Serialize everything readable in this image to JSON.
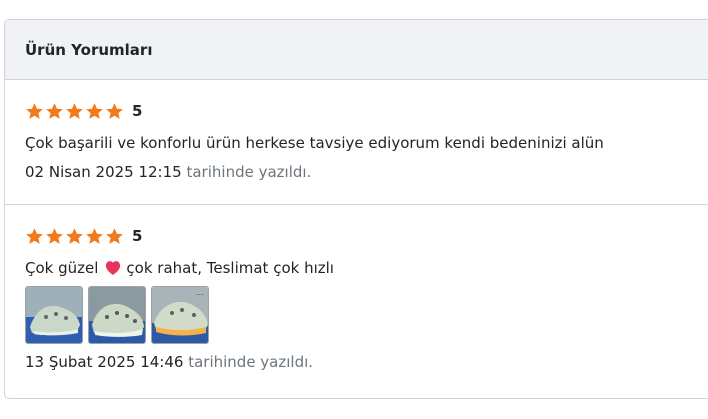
{
  "panel": {
    "title": "Ürün Yorumları"
  },
  "colors": {
    "star": "#f27a1a",
    "heart": "#e8345a",
    "muted": "#6c757d"
  },
  "reviews": [
    {
      "rating": 5,
      "rating_label": "5",
      "comment": "Çok başarili ve konforlu ürün herkese tavsiye ediyorum kendi bedeninizi alün",
      "date": "02 Nisan 2025 12:15",
      "date_suffix": "tarihinde yazıldı."
    },
    {
      "rating": 5,
      "rating_label": "5",
      "comment_part1": "Çok güzel",
      "comment_emoji": "heart-emoji",
      "comment_part2": "çok rahat, Teslimat çok hızlı",
      "photos": [
        "shoe-photo-1",
        "shoe-photo-2",
        "shoe-photo-3"
      ],
      "date": "13 Şubat 2025 14:46",
      "date_suffix": "tarihinde yazıldı."
    }
  ]
}
